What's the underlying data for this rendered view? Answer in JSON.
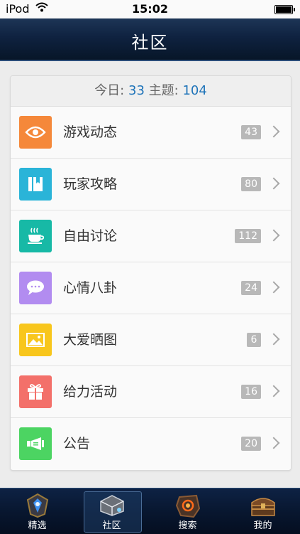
{
  "status_bar": {
    "carrier": "iPod",
    "time": "15:02"
  },
  "nav": {
    "title": "社区"
  },
  "summary": {
    "today_label": "今日:",
    "today_value": "33",
    "topic_label": "主题:",
    "topic_value": "104"
  },
  "forums": [
    {
      "label": "游戏动态",
      "count": "43",
      "icon": "eye-icon",
      "color": "#f5883a"
    },
    {
      "label": "玩家攻略",
      "count": "80",
      "icon": "book-icon",
      "color": "#2ab4d8"
    },
    {
      "label": "自由讨论",
      "count": "112",
      "icon": "coffee-cup-icon",
      "color": "#17b9a6"
    },
    {
      "label": "心情八卦",
      "count": "24",
      "icon": "chat-bubble-icon",
      "color": "#b28cf0"
    },
    {
      "label": "大爱晒图",
      "count": "6",
      "icon": "image-icon",
      "color": "#f8c61c"
    },
    {
      "label": "给力活动",
      "count": "16",
      "icon": "gift-icon",
      "color": "#f3706a"
    },
    {
      "label": "公告",
      "count": "20",
      "icon": "megaphone-icon",
      "color": "#4cd462"
    }
  ],
  "tabs": [
    {
      "label": "精选",
      "icon": "emblem-icon",
      "active": false
    },
    {
      "label": "社区",
      "icon": "community-icon",
      "active": true
    },
    {
      "label": "搜索",
      "icon": "search-stone-icon",
      "active": false
    },
    {
      "label": "我的",
      "icon": "treasure-chest-icon",
      "active": false
    }
  ]
}
